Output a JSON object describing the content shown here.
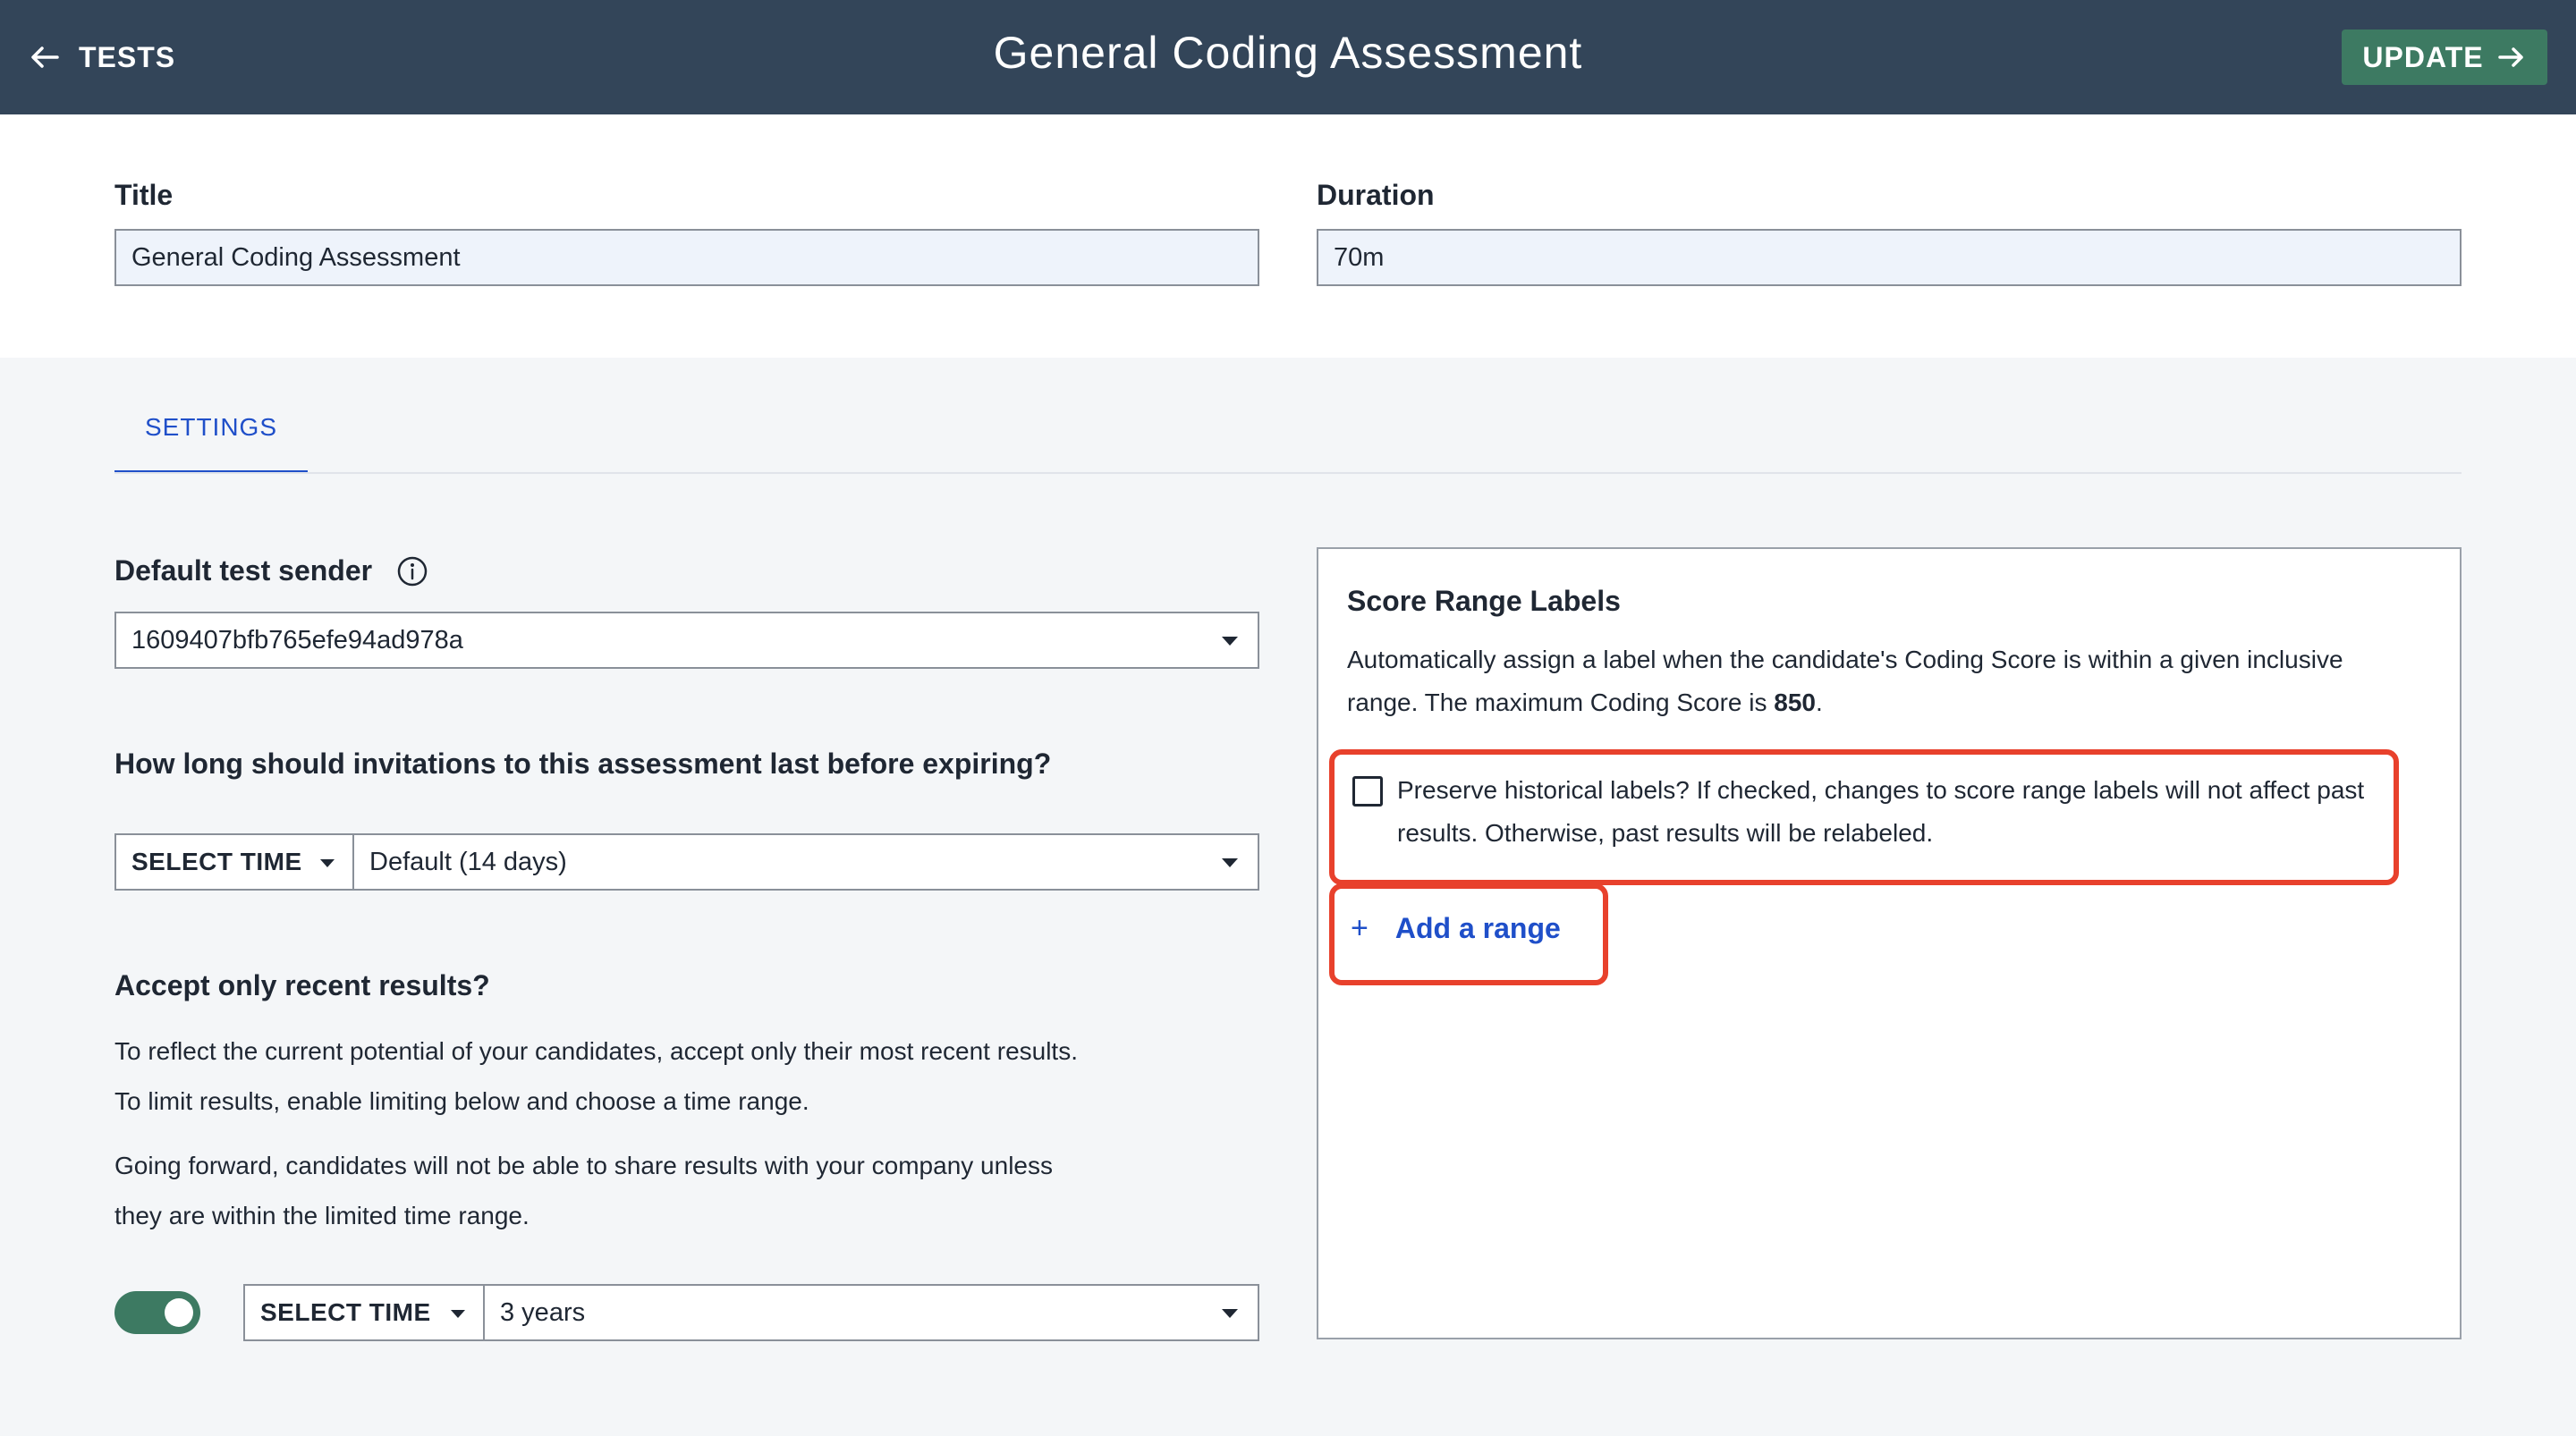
{
  "header": {
    "back_label": "TESTS",
    "title": "General Coding Assessment",
    "update_label": "UPDATE"
  },
  "form": {
    "title_label": "Title",
    "title_value": "General Coding Assessment",
    "duration_label": "Duration",
    "duration_value": "70m"
  },
  "tabs": [
    {
      "label": "SETTINGS",
      "active": true
    }
  ],
  "settings": {
    "sender_label": "Default test sender",
    "sender_value": "1609407bfb765efe94ad978a",
    "expiry_question": "How long should invitations to this assessment last before expiring?",
    "expiry_time_button": "SELECT TIME",
    "expiry_value": "Default (14 days)",
    "recent_label": "Accept only recent results?",
    "recent_desc_1": "To reflect the current potential of your candidates, accept only their most recent results.",
    "recent_desc_2": "To limit results, enable limiting below and choose a time range.",
    "recent_desc_3": "Going forward, candidates will not be able to share results with your company unless",
    "recent_desc_4": "they are within the limited time range.",
    "recent_time_button": "SELECT TIME",
    "recent_value": "3 years",
    "recent_enabled": true
  },
  "score_panel": {
    "title": "Score Range Labels",
    "desc_prefix": "Automatically assign a label when the candidate's Coding Score is within a given inclusive range. The maximum Coding Score is ",
    "max_score": "850",
    "desc_suffix": ".",
    "preserve_text": "Preserve historical labels? If checked, changes to score range labels will not affect past results. Otherwise, past results will be relabeled.",
    "preserve_checked": false,
    "add_plus": "+",
    "add_range_label": "Add a range"
  },
  "colors": {
    "header_bg": "#334559",
    "accent_green": "#3d7a62",
    "link_blue": "#1f4fc9",
    "highlight_red": "#e8412c"
  }
}
